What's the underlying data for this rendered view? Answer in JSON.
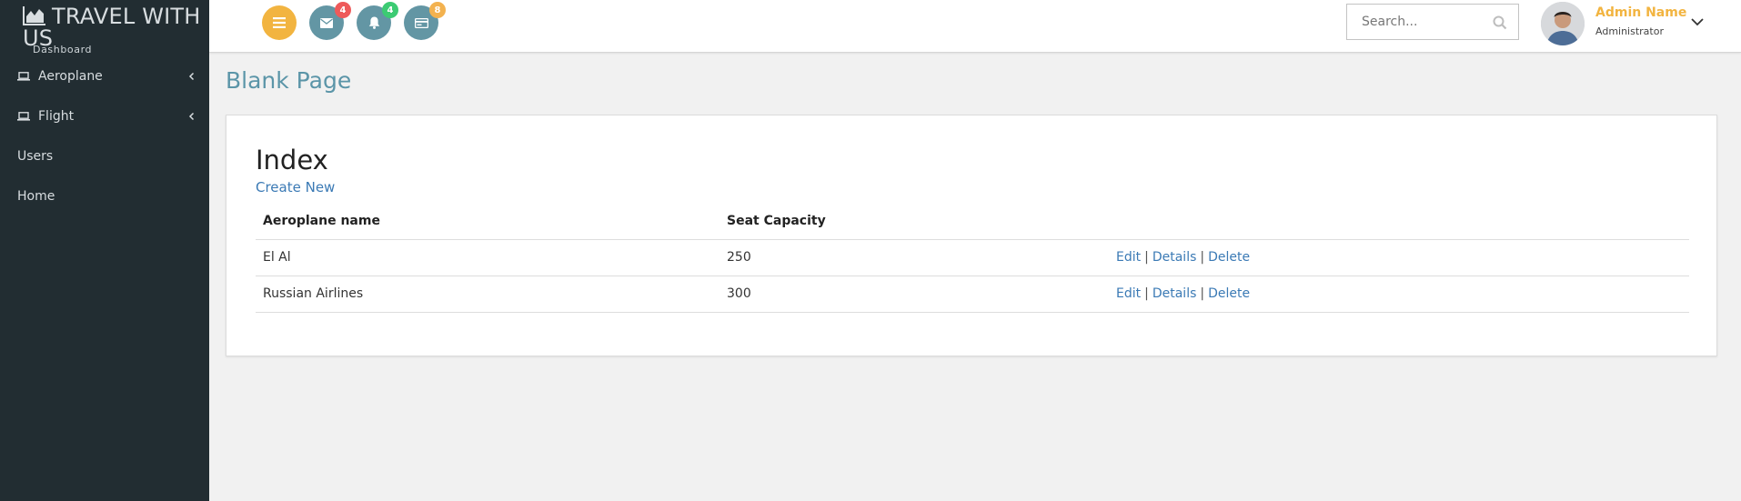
{
  "brand": {
    "title": "TRAVEL WITH US",
    "subtitle": "Dashboard"
  },
  "sidebar": {
    "items": [
      {
        "label": "Aeroplane",
        "icon": "laptop-icon",
        "has_chevron": true
      },
      {
        "label": "Flight",
        "icon": "laptop-icon",
        "has_chevron": true
      },
      {
        "label": "Users"
      },
      {
        "label": "Home"
      }
    ]
  },
  "header": {
    "buttons": {
      "menu": {
        "icon": "menu-icon"
      },
      "messages": {
        "icon": "mail-icon",
        "badge": "4",
        "badge_color": "#ee5a5a"
      },
      "notifications": {
        "icon": "bell-icon",
        "badge": "4",
        "badge_color": "#3ccb73"
      },
      "tasks": {
        "icon": "card-icon",
        "badge": "8",
        "badge_color": "#f3b24f"
      }
    },
    "search": {
      "placeholder": "Search..."
    },
    "user": {
      "name": "Admin Name",
      "role": "Administrator"
    }
  },
  "page": {
    "title": "Blank Page"
  },
  "content": {
    "heading": "Index",
    "create_link": "Create New",
    "table": {
      "headers": [
        "Aeroplane name",
        "Seat Capacity",
        ""
      ],
      "rows": [
        {
          "name": "El Al",
          "capacity": "250"
        },
        {
          "name": "Russian Airlines",
          "capacity": "300"
        }
      ],
      "actions": {
        "edit": "Edit",
        "details": "Details",
        "delete": "Delete",
        "separator": "|"
      }
    }
  },
  "colors": {
    "sidebar_bg": "#222d32",
    "accent": "#f2b440",
    "teal": "#6396a4",
    "link": "#3b7ab5",
    "title": "#5b95a8"
  }
}
